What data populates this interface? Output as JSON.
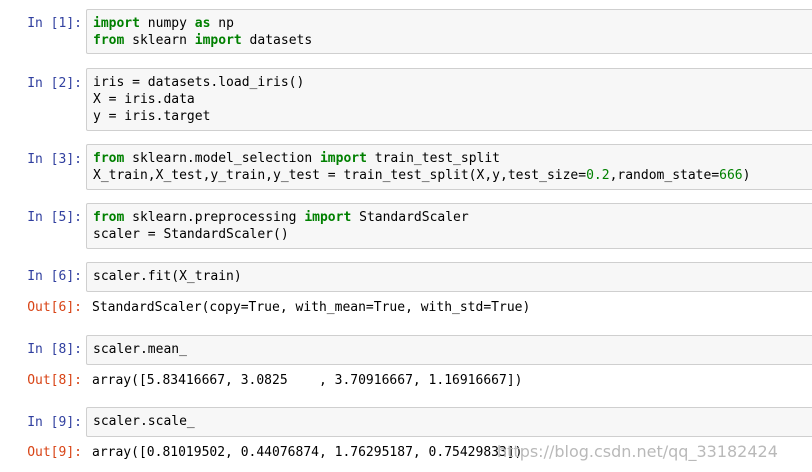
{
  "cells": [
    {
      "in_prompt": "In [1]:",
      "code_lines": [
        [
          {
            "t": "import",
            "k": "kw"
          },
          {
            "t": " numpy "
          },
          {
            "t": "as",
            "k": "kw"
          },
          {
            "t": " np"
          }
        ],
        [
          {
            "t": "from",
            "k": "kw"
          },
          {
            "t": " sklearn "
          },
          {
            "t": "import",
            "k": "kw"
          },
          {
            "t": " datasets"
          }
        ]
      ]
    },
    {
      "in_prompt": "In [2]:",
      "code_lines": [
        [
          {
            "t": "iris = datasets.load_iris()"
          }
        ],
        [
          {
            "t": "X = iris.data"
          }
        ],
        [
          {
            "t": "y = iris.target"
          }
        ]
      ]
    },
    {
      "in_prompt": "In [3]:",
      "code_lines": [
        [
          {
            "t": "from",
            "k": "kw"
          },
          {
            "t": " sklearn.model_selection "
          },
          {
            "t": "import",
            "k": "kw"
          },
          {
            "t": " train_test_split"
          }
        ],
        [
          {
            "t": "X_train,X_test,y_train,y_test = train_test_split(X,y,test_size="
          },
          {
            "t": "0.2",
            "k": "num"
          },
          {
            "t": ",random_state="
          },
          {
            "t": "666",
            "k": "num"
          },
          {
            "t": ")"
          }
        ]
      ]
    },
    {
      "in_prompt": "In [5]:",
      "code_lines": [
        [
          {
            "t": "from",
            "k": "kw"
          },
          {
            "t": " sklearn.preprocessing "
          },
          {
            "t": "import",
            "k": "kw"
          },
          {
            "t": " StandardScaler"
          }
        ],
        [
          {
            "t": "scaler = StandardScaler()"
          }
        ]
      ]
    },
    {
      "in_prompt": "In [6]:",
      "code_lines": [
        [
          {
            "t": "scaler.fit(X_train)"
          }
        ]
      ],
      "out_prompt": "Out[6]:",
      "output": "StandardScaler(copy=True, with_mean=True, with_std=True)"
    },
    {
      "in_prompt": "In [8]:",
      "code_lines": [
        [
          {
            "t": "scaler.mean_"
          }
        ]
      ],
      "out_prompt": "Out[8]:",
      "output": "array([5.83416667, 3.0825    , 3.70916667, 1.16916667])"
    },
    {
      "in_prompt": "In [9]:",
      "code_lines": [
        [
          {
            "t": "scaler.scale_"
          }
        ]
      ],
      "out_prompt": "Out[9]:",
      "output": "array([0.81019502, 0.44076874, 1.76295187, 0.75429833])"
    }
  ],
  "watermark": "https://blog.csdn.net/qq_33182424",
  "colors": {
    "in_prompt": "#303f9f",
    "out_prompt": "#d84315",
    "keyword": "#008000",
    "number": "#008000",
    "cell_background": "#f7f7f7",
    "cell_border": "#cfcfcf"
  }
}
